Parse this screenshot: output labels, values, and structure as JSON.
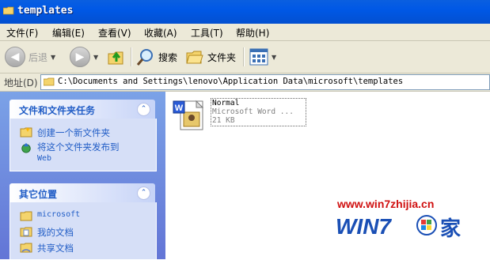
{
  "window": {
    "title": "templates"
  },
  "menu": [
    "文件(F)",
    "编辑(E)",
    "查看(V)",
    "收藏(A)",
    "工具(T)",
    "帮助(H)"
  ],
  "toolbar": {
    "back_label": "后退",
    "search_label": "搜索",
    "folders_label": "文件夹"
  },
  "address": {
    "label": "地址(D)",
    "path": "C:\\Documents and Settings\\lenovo\\Application Data\\microsoft\\templates"
  },
  "tasks_panel": {
    "title": "文件和文件夹任务",
    "items": [
      {
        "label": "创建一个新文件夹",
        "icon": "new-folder-icon"
      },
      {
        "label": "将这个文件夹发布到",
        "sub": "Web",
        "icon": "publish-web-icon"
      }
    ]
  },
  "places_panel": {
    "title": "其它位置",
    "items": [
      {
        "label": "microsoft",
        "icon": "folder-icon"
      },
      {
        "label": "我的文档",
        "icon": "my-documents-icon"
      },
      {
        "label": "共享文档",
        "icon": "shared-documents-icon"
      }
    ]
  },
  "file": {
    "name": "Normal",
    "type": "Microsoft Word ...",
    "size": "21 KB",
    "icon": "word-document-icon"
  },
  "watermark": {
    "url": "www.win7zhijia.cn",
    "logo_text": "WIN7家"
  },
  "colors": {
    "title_bar": "#0058e6",
    "panel_title": "#215dc6",
    "sidebar": "#6f8fe0",
    "watermark_red": "#d01010"
  }
}
